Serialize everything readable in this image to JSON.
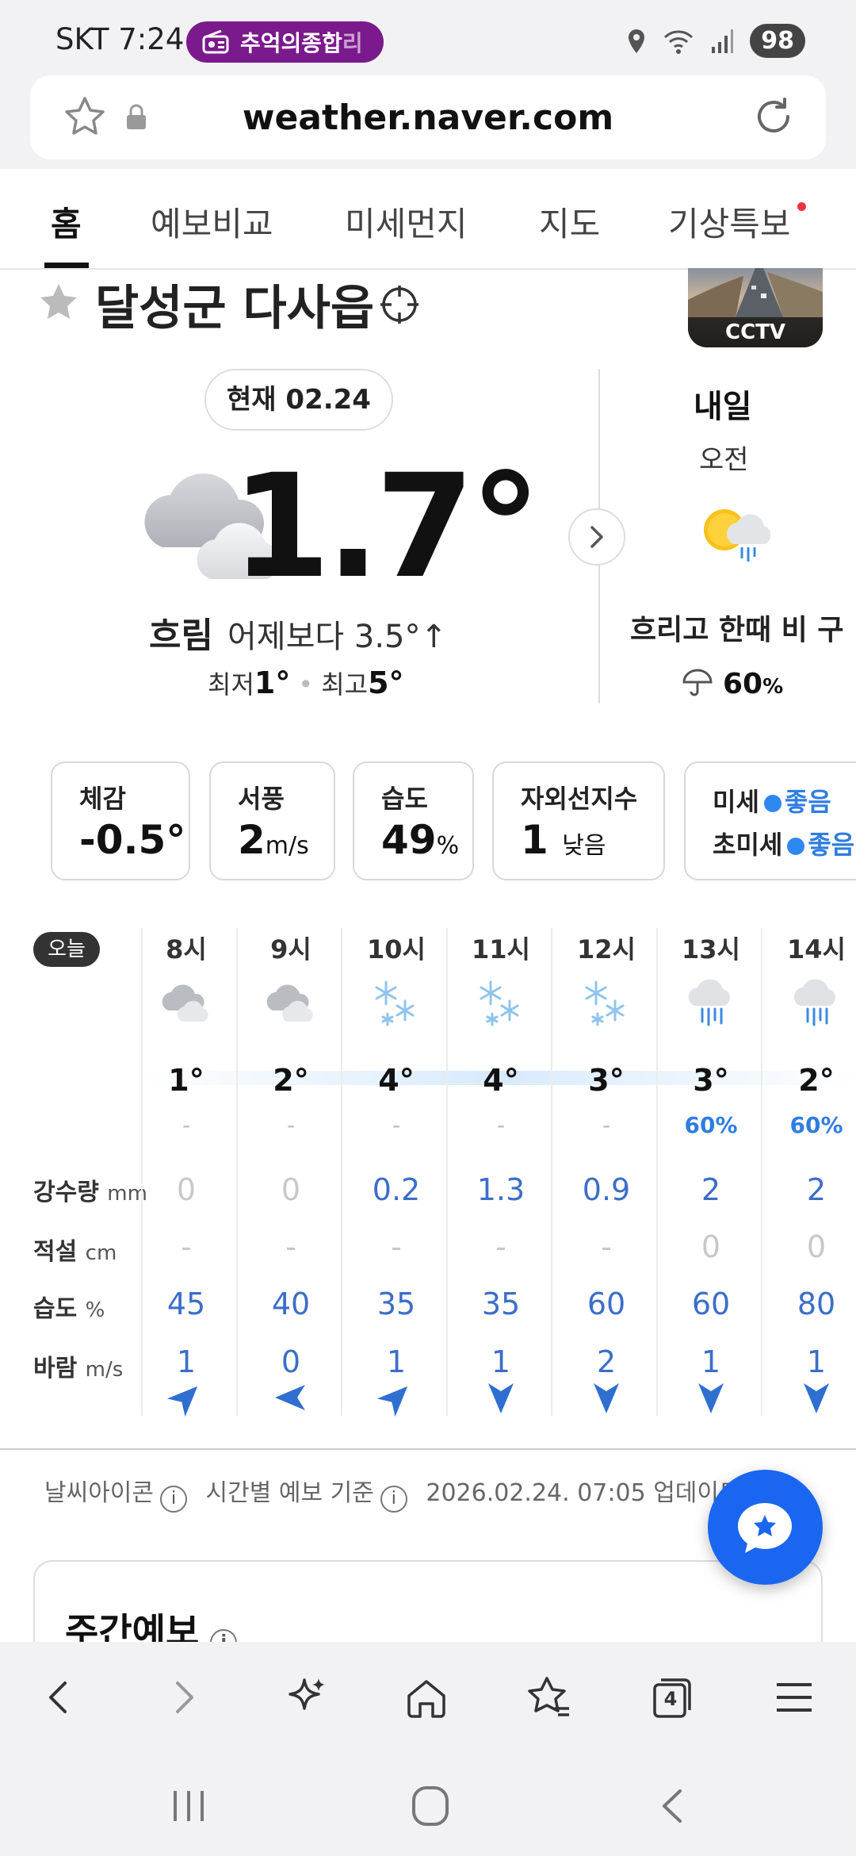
{
  "status_bar": {
    "carrier": "SKT",
    "time": "7:24",
    "chip_label": "추억의종합",
    "chip_fade": "리",
    "battery": "98"
  },
  "browser": {
    "url": "weather.naver.com"
  },
  "tabs": [
    {
      "label": "홈",
      "active": true
    },
    {
      "label": "예보비교"
    },
    {
      "label": "미세먼지"
    },
    {
      "label": "지도"
    },
    {
      "label": "기상특보",
      "has_alert": true
    }
  ],
  "location": {
    "name": "달성군 다사읍",
    "cctv_label": "CCTV"
  },
  "current": {
    "date_pill": "현재 02.24",
    "temperature": "1.7°",
    "condition": "흐림",
    "compare": "어제보다 3.5°↑",
    "min_label": "최저",
    "min_value": "1°",
    "max_label": "최고",
    "max_value": "5°"
  },
  "tomorrow": {
    "title": "내일",
    "period": "오전",
    "condition": "흐리고 한때 비 구",
    "pop_value": "60",
    "pop_unit": "%"
  },
  "summary_cards": {
    "feels": {
      "label": "체감",
      "value": "-0.5°"
    },
    "wind": {
      "label": "서풍",
      "value": "2",
      "unit": "m/s"
    },
    "humidity": {
      "label": "습도",
      "value": "49",
      "unit": "%"
    },
    "uv": {
      "label": "자외선지수",
      "value": "1",
      "unit": "낮음"
    },
    "dust": {
      "pm10_label": "미세",
      "pm10_value": "좋음",
      "pm25_label": "초미세",
      "pm25_value": "좋음"
    }
  },
  "hourly": {
    "today_badge": "오늘",
    "row_labels": {
      "precip": "강수량",
      "precip_unit": "mm",
      "snow": "적설",
      "snow_unit": "cm",
      "humidity": "습도",
      "humidity_unit": "%",
      "wind": "바람",
      "wind_unit": "m/s"
    },
    "hours": [
      {
        "time": "8시",
        "icon": "cloudy-icon",
        "temp": "1°",
        "pop": "-",
        "precip": "0",
        "snow": "-",
        "humidity": "45",
        "wind": "1",
        "wind_dir": "northeast"
      },
      {
        "time": "9시",
        "icon": "cloudy-icon",
        "temp": "2°",
        "pop": "-",
        "precip": "0",
        "snow": "-",
        "humidity": "40",
        "wind": "0",
        "wind_dir": "east"
      },
      {
        "time": "10시",
        "icon": "snow-icon",
        "temp": "4°",
        "pop": "-",
        "precip": "0.2",
        "snow": "-",
        "humidity": "35",
        "wind": "1",
        "wind_dir": "northeast"
      },
      {
        "time": "11시",
        "icon": "snow-icon",
        "temp": "4°",
        "pop": "-",
        "precip": "1.3",
        "snow": "-",
        "humidity": "35",
        "wind": "1",
        "wind_dir": "north"
      },
      {
        "time": "12시",
        "icon": "snow-icon",
        "temp": "3°",
        "pop": "-",
        "precip": "0.9",
        "snow": "-",
        "humidity": "60",
        "wind": "2",
        "wind_dir": "north"
      },
      {
        "time": "13시",
        "icon": "rain-icon",
        "temp": "3°",
        "pop": "60%",
        "precip": "2",
        "snow": "0",
        "humidity": "60",
        "wind": "1",
        "wind_dir": "north"
      },
      {
        "time": "14시",
        "icon": "rain-icon",
        "temp": "2°",
        "pop": "60%",
        "precip": "2",
        "snow": "0",
        "humidity": "80",
        "wind": "1",
        "wind_dir": "north"
      }
    ]
  },
  "footer": {
    "icon_info": "날씨아이콘",
    "basis_info": "시간별 예보 기준",
    "updated": "2026.02.24. 07:05 업데이트",
    "weekly_title": "주간예보"
  },
  "toolbar": {
    "tabs_count": "4"
  },
  "colors": {
    "accent_blue": "#2f7de1",
    "fab_blue": "#1a66f0",
    "chip_purple": "#7a1a8c",
    "alert_red": "#f0323c"
  }
}
